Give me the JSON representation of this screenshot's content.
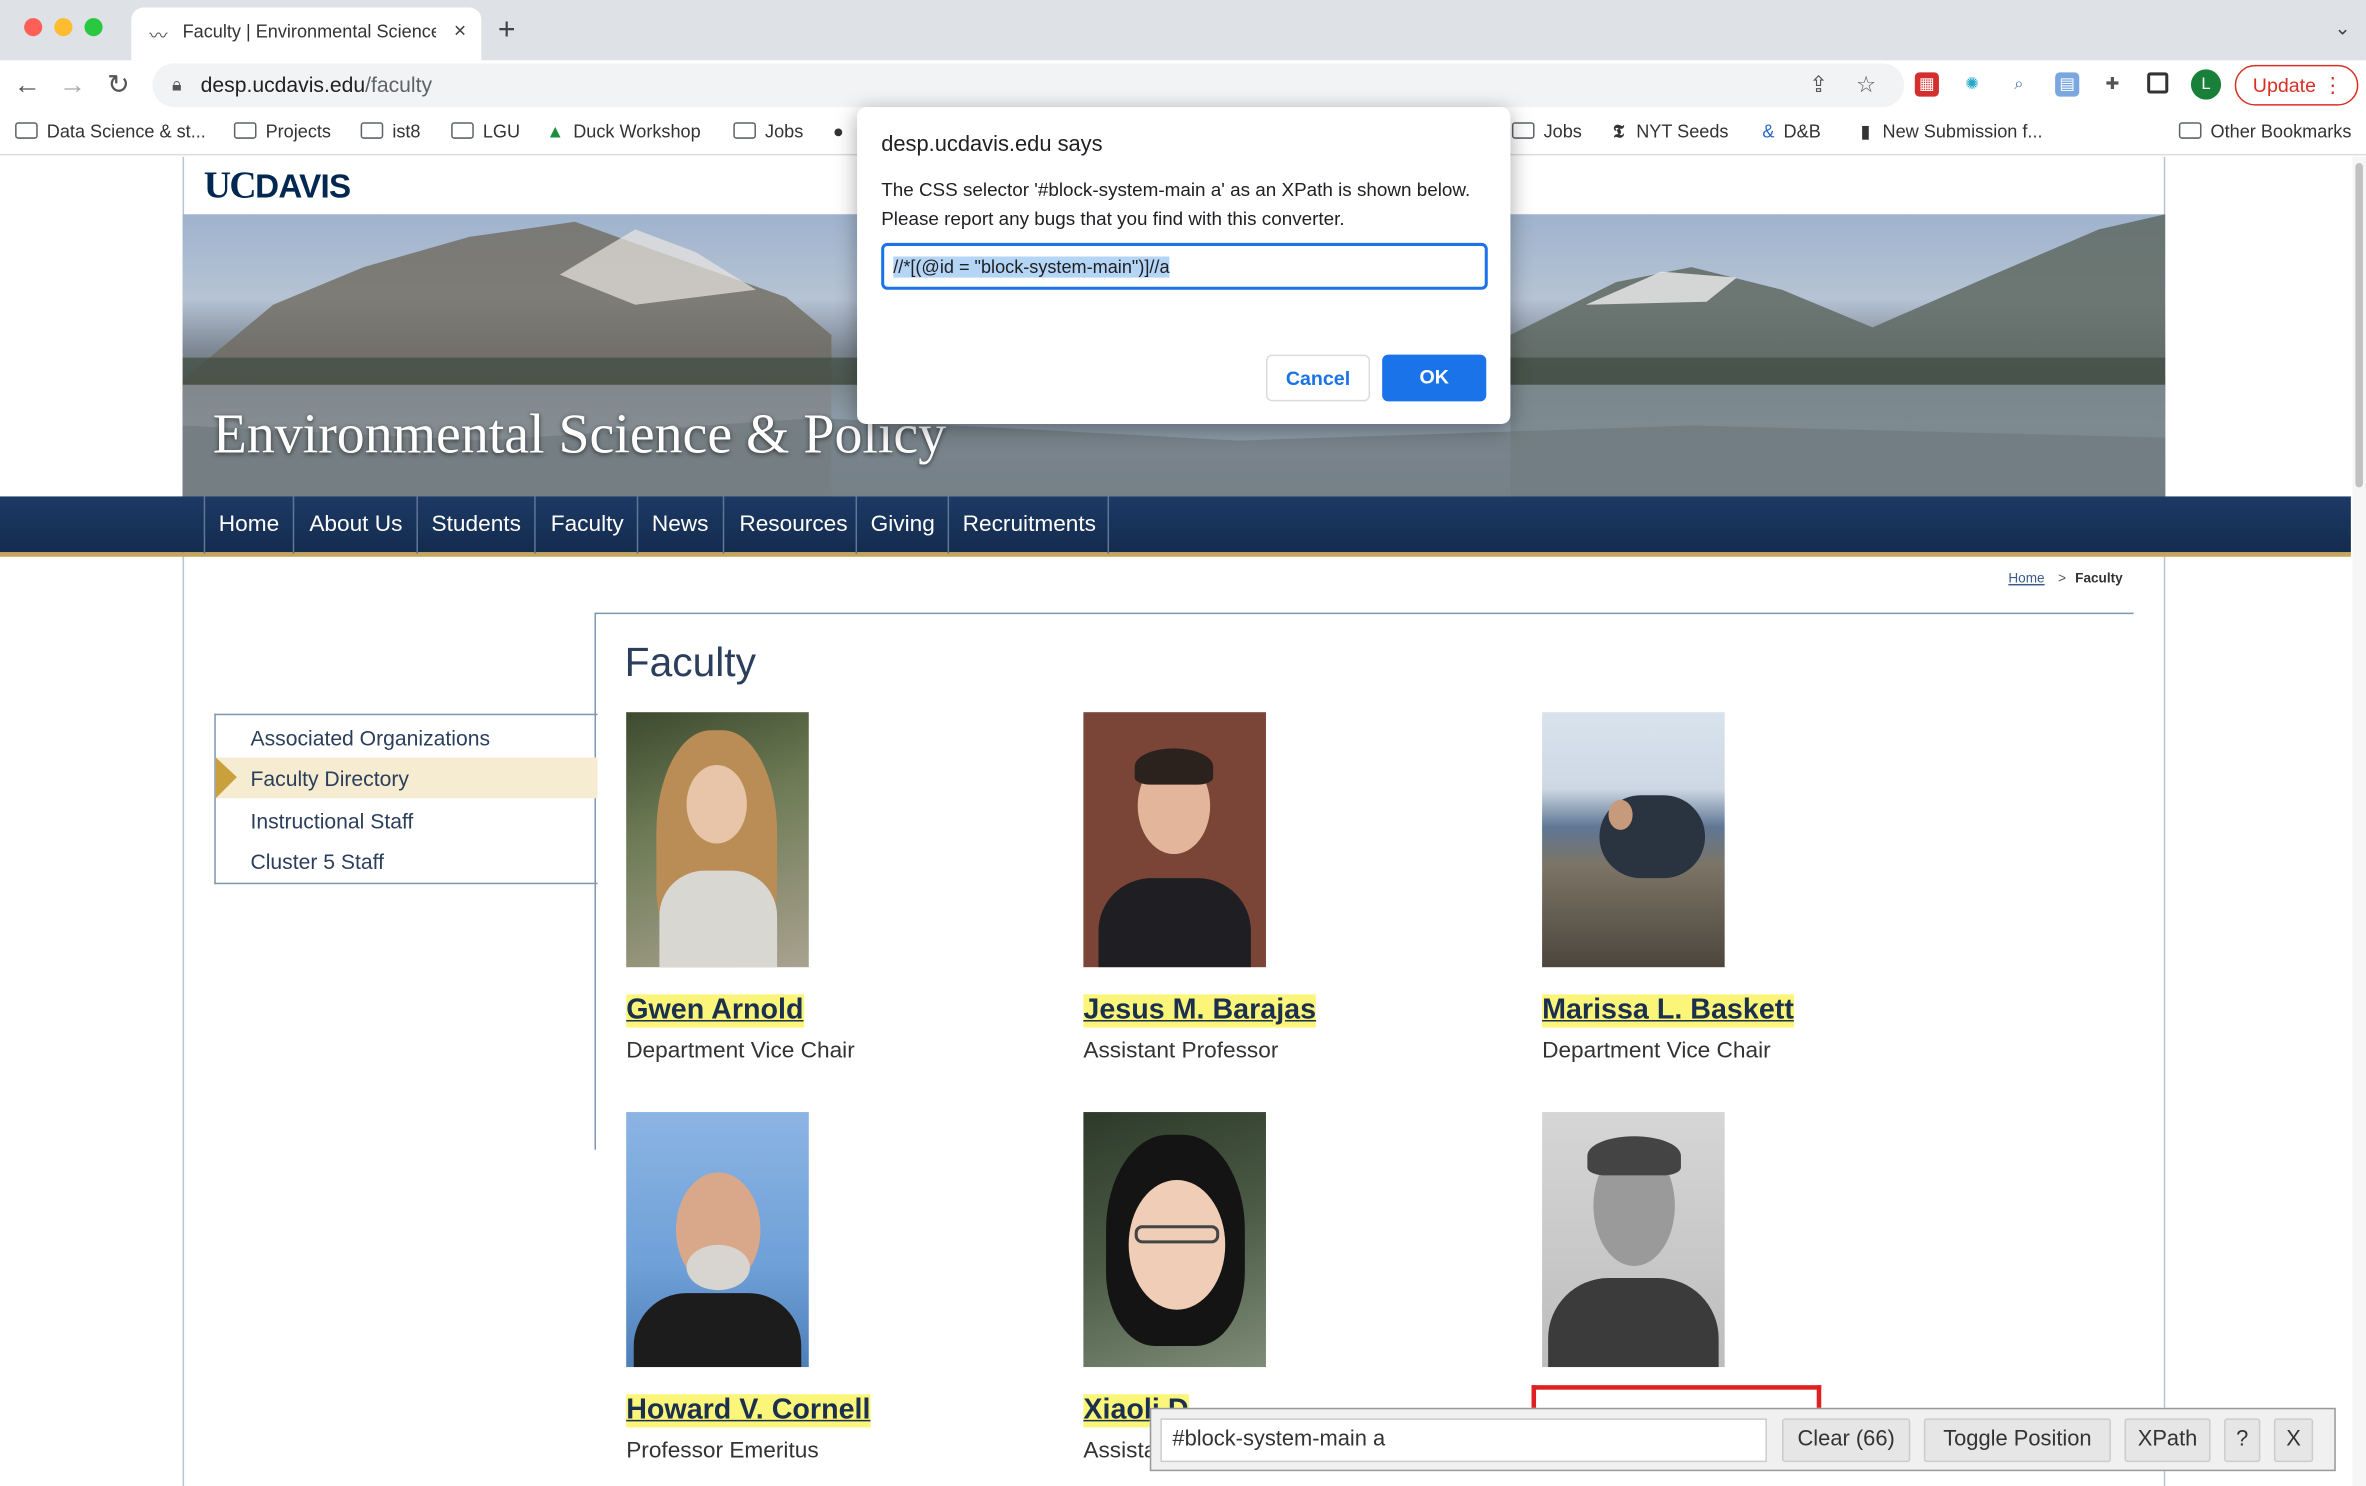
{
  "browser": {
    "tab_title": "Faculty | Environmental Science & Policy",
    "url_host": "desp.ucdavis.edu",
    "url_path": "/faculty",
    "update_label": "Update",
    "profile_initial": "L",
    "new_tab_symbol": "+",
    "tab_close_symbol": "×"
  },
  "bookmarks": [
    {
      "label": "Data Science & st...",
      "icon": "folder-icon"
    },
    {
      "label": "Projects",
      "icon": "folder-icon"
    },
    {
      "label": "ist8",
      "icon": "folder-icon"
    },
    {
      "label": "LGU",
      "icon": "folder-icon"
    },
    {
      "label": "Duck Workshop",
      "icon": "google-drive-icon"
    },
    {
      "label": "Jobs",
      "icon": "folder-icon"
    },
    {
      "label": "Jobs",
      "icon": "folder-icon"
    },
    {
      "label": "NYT Seeds",
      "icon": "nyt-icon"
    },
    {
      "label": "D&B",
      "icon": "link-icon"
    },
    {
      "label": "New Submission f...",
      "icon": "bookmark-icon"
    },
    {
      "label": "Other Bookmarks",
      "icon": "folder-icon"
    }
  ],
  "site": {
    "logo_uc": "UC",
    "logo_davis": "DAVIS",
    "hero_title": "Environmental Science & Policy",
    "nav": [
      "Home",
      "About Us",
      "Students",
      "Faculty",
      "News",
      "Resources",
      "Giving",
      "Recruitments"
    ],
    "breadcrumb": {
      "home": "Home",
      "separator": ">",
      "current": "Faculty"
    },
    "page_title": "Faculty",
    "sidebar": [
      {
        "label": "Associated Organizations",
        "active": false
      },
      {
        "label": "Faculty Directory",
        "active": true
      },
      {
        "label": "Instructional Staff",
        "active": false
      },
      {
        "label": "Cluster 5 Staff",
        "active": false
      }
    ],
    "faculty": [
      {
        "name": "Gwen Arnold",
        "title": "Department Vice Chair"
      },
      {
        "name": "Jesus M. Barajas",
        "title": "Assistant Professor"
      },
      {
        "name": "Marissa L. Baskett",
        "title": "Department Vice Chair"
      },
      {
        "name": "Howard V. Cornell",
        "title": "Professor Emeritus"
      },
      {
        "name": "Xiaoli D",
        "title": "Assista"
      },
      {
        "name": "",
        "title": ""
      }
    ]
  },
  "dialog": {
    "header": "desp.ucdavis.edu says",
    "message": "The CSS selector '#block-system-main a' as an XPath is shown below.  Please report any bugs that you find with this converter.",
    "input_value": "//*[(@id = \"block-system-main\")]//a",
    "cancel_label": "Cancel",
    "ok_label": "OK"
  },
  "selector_gadget": {
    "selector": "#block-system-main a",
    "clear_label": "Clear (66)",
    "toggle_label": "Toggle Position",
    "xpath_label": "XPath",
    "help_label": "?",
    "close_label": "X"
  },
  "colors": {
    "ucd_navy": "#022851",
    "ucd_gold": "#c8a55b",
    "highlight_yellow": "#fbf67a",
    "selection_red": "#e02020",
    "chrome_blue": "#1a73e8"
  }
}
